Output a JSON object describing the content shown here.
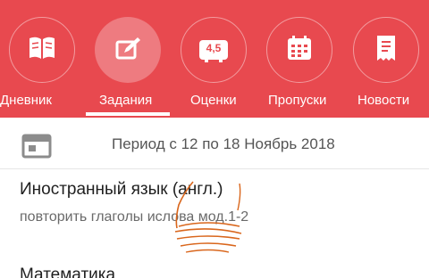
{
  "tabs": [
    {
      "label": "Дневник",
      "icon": "book-icon",
      "active": false
    },
    {
      "label": "Задания",
      "icon": "edit-icon",
      "active": true
    },
    {
      "label": "Оценки",
      "icon": "grades-icon",
      "badge": "4,5",
      "active": false
    },
    {
      "label": "Пропуски",
      "icon": "calendar-grid-icon",
      "active": false
    },
    {
      "label": "Новости",
      "icon": "news-icon",
      "active": false
    }
  ],
  "period": {
    "text": "Период с 12 по 18 Ноябрь 2018",
    "icon": "calendar-icon"
  },
  "assignments": [
    {
      "subject": "Иностранный язык (англ.)",
      "note": "повторить глаголы ислова мод.1-2"
    },
    {
      "subject": "Математика"
    }
  ],
  "colors": {
    "accent": "#e8494f",
    "annotation": "#d9661c"
  }
}
